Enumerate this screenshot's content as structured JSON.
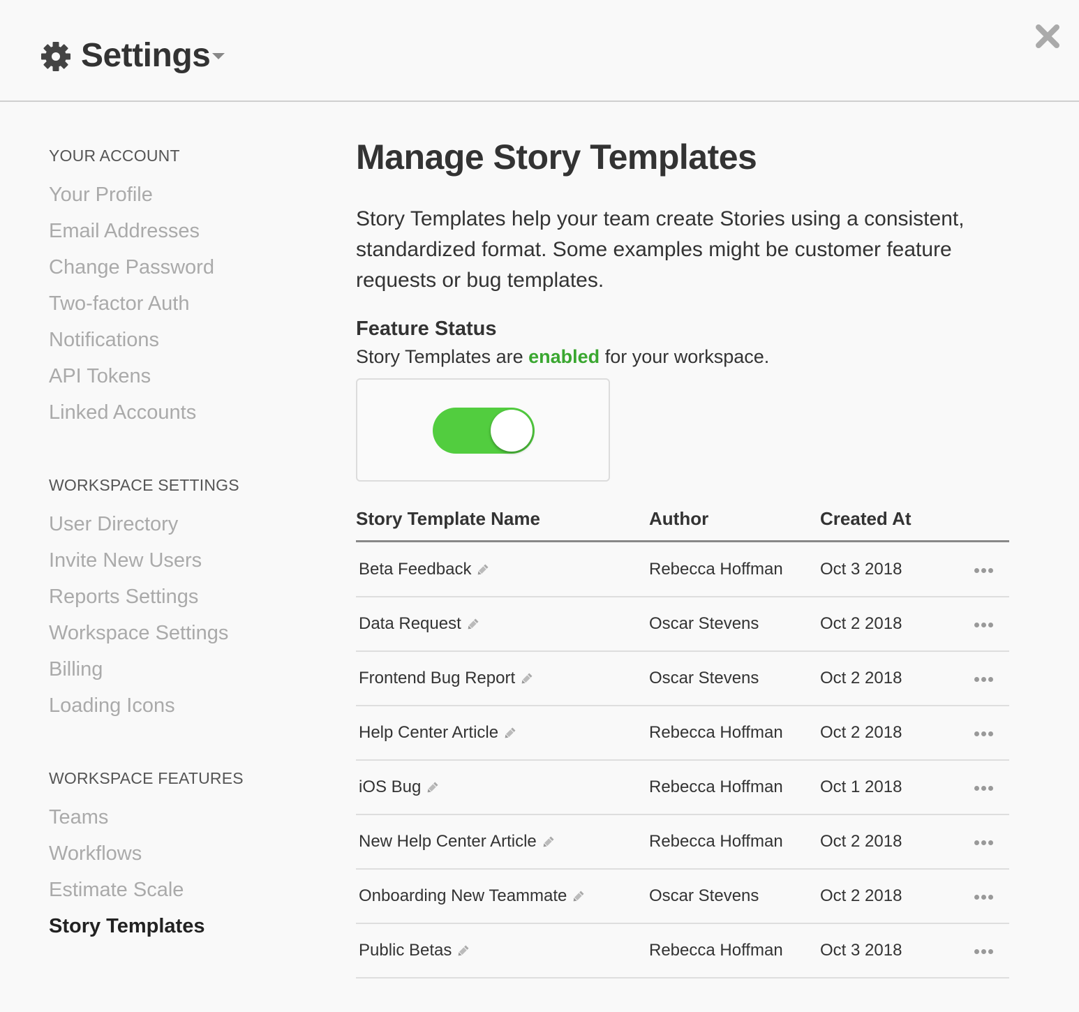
{
  "header": {
    "title": "Settings",
    "icons": {
      "settings": "gear-icon",
      "menu": "caret-down-icon",
      "close": "close-icon"
    }
  },
  "sidebar": {
    "sections": [
      {
        "label": "YOUR ACCOUNT",
        "items": [
          "Your Profile",
          "Email Addresses",
          "Change Password",
          "Two-factor Auth",
          "Notifications",
          "API Tokens",
          "Linked Accounts"
        ]
      },
      {
        "label": "WORKSPACE SETTINGS",
        "items": [
          "User Directory",
          "Invite New Users",
          "Reports Settings",
          "Workspace Settings",
          "Billing",
          "Loading Icons"
        ]
      },
      {
        "label": "WORKSPACE FEATURES",
        "items": [
          "Teams",
          "Workflows",
          "Estimate Scale",
          "Story Templates"
        ]
      }
    ],
    "active_item": "Story Templates"
  },
  "main": {
    "title": "Manage Story Templates",
    "intro": "Story Templates help your team create Stories using a consistent, standardized format. Some examples might be customer feature requests or bug templates.",
    "feature_status": {
      "heading": "Feature Status",
      "text_before": "Story Templates are",
      "status_word": "enabled",
      "text_after": "for your workspace.",
      "toggle_on": true
    },
    "table": {
      "columns": [
        "Story Template Name",
        "Author",
        "Created At"
      ],
      "rows": [
        {
          "name": "Beta Feedback",
          "author": "Rebecca Hoffman",
          "created": "Oct 3 2018"
        },
        {
          "name": "Data Request",
          "author": "Oscar Stevens",
          "created": "Oct 2 2018"
        },
        {
          "name": "Frontend Bug Report",
          "author": "Oscar Stevens",
          "created": "Oct 2 2018"
        },
        {
          "name": "Help Center Article",
          "author": "Rebecca Hoffman",
          "created": "Oct 2 2018"
        },
        {
          "name": "iOS Bug",
          "author": "Rebecca Hoffman",
          "created": "Oct 1 2018"
        },
        {
          "name": "New Help Center Article",
          "author": "Rebecca Hoffman",
          "created": "Oct 2 2018"
        },
        {
          "name": "Onboarding New Teammate",
          "author": "Oscar Stevens",
          "created": "Oct 2 2018"
        },
        {
          "name": "Public Betas",
          "author": "Rebecca Hoffman",
          "created": "Oct 3 2018"
        }
      ],
      "row_icons": {
        "edit": "pencil-icon",
        "actions": "more-icon"
      }
    }
  },
  "colors": {
    "background": "#f9f9f9",
    "enabled_green": "#3aa730",
    "toggle_green": "#52cd3f",
    "nav_inactive": "#aaaaaa",
    "text_dark": "#333333"
  }
}
